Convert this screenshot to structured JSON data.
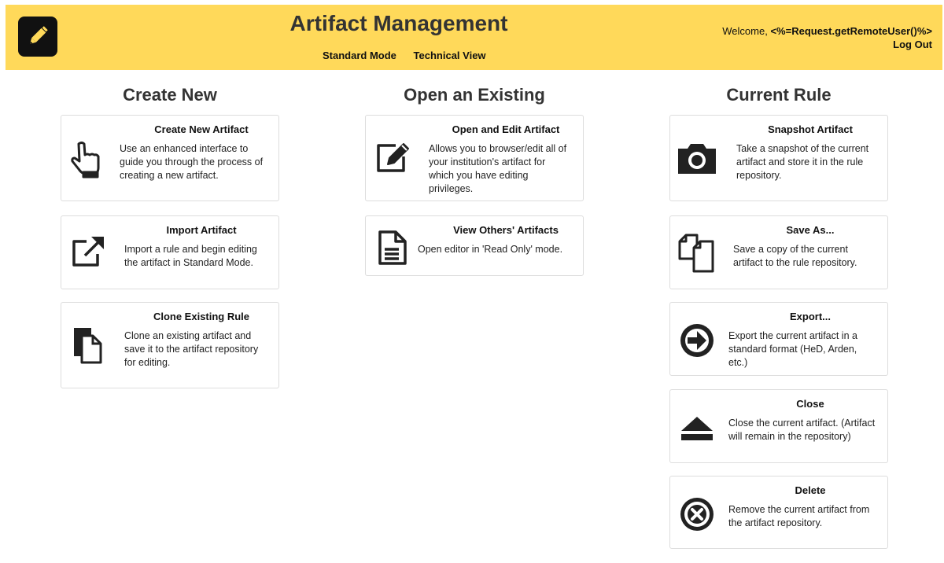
{
  "header": {
    "title": "Artifact Management",
    "modes": [
      "Standard Mode",
      "Technical View"
    ],
    "welcome_prefix": "Welcome,",
    "user": "<%=Request.getRemoteUser()%>",
    "logout": "Log Out",
    "background": "#ffd95a"
  },
  "columns": {
    "create": {
      "title": "Create New",
      "cards": [
        {
          "title": "Create New Artifact",
          "desc": "Use an enhanced interface to guide you through the process of creating a new artifact.",
          "icon": "pointing-hand-icon"
        },
        {
          "title": "Import Artifact",
          "desc": "Import a rule and begin editing the artifact in Standard Mode.",
          "icon": "external-link-icon"
        },
        {
          "title": "Clone Existing Rule",
          "desc": "Clone an existing artifact and save it to the artifact repository for editing.",
          "icon": "clone-icon"
        }
      ]
    },
    "open": {
      "title": "Open an Existing",
      "cards": [
        {
          "title": "Open and Edit Artifact",
          "desc": "Allows you to browser/edit all of your institution's artifact for which you have editing privileges.",
          "icon": "edit-icon"
        },
        {
          "title": "View Others' Artifacts",
          "desc": "Open editor in 'Read Only' mode.",
          "icon": "document-icon"
        }
      ]
    },
    "current": {
      "title": "Current Rule",
      "cards": [
        {
          "title": "Snapshot Artifact",
          "desc": "Take a snapshot of the current artifact and store it in the rule repository.",
          "icon": "camera-icon"
        },
        {
          "title": "Save As...",
          "desc": "Save a copy of the current artifact to the rule repository.",
          "icon": "copy-icon"
        },
        {
          "title": "Export...",
          "desc": "Export the current artifact in a standard format (HeD, Arden, etc.)",
          "icon": "arrow-right-circle-icon"
        },
        {
          "title": "Close",
          "desc": "Close the current artifact. (Artifact will remain in the repository)",
          "icon": "eject-icon"
        },
        {
          "title": "Delete",
          "desc": "Remove the current artifact from the artifact repository.",
          "icon": "delete-circle-icon"
        }
      ]
    }
  }
}
